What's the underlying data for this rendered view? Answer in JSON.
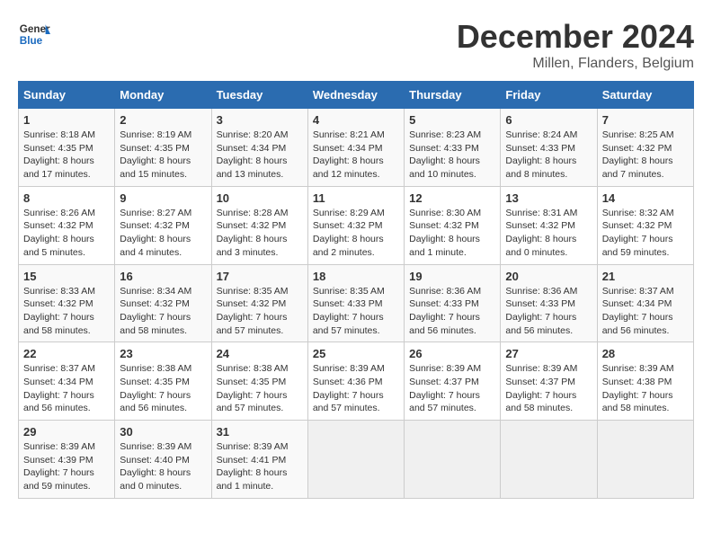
{
  "header": {
    "logo_line1": "General",
    "logo_line2": "Blue",
    "month": "December 2024",
    "location": "Millen, Flanders, Belgium"
  },
  "days_of_week": [
    "Sunday",
    "Monday",
    "Tuesday",
    "Wednesday",
    "Thursday",
    "Friday",
    "Saturday"
  ],
  "weeks": [
    [
      {
        "day": 1,
        "lines": [
          "Sunrise: 8:18 AM",
          "Sunset: 4:35 PM",
          "Daylight: 8 hours",
          "and 17 minutes."
        ]
      },
      {
        "day": 2,
        "lines": [
          "Sunrise: 8:19 AM",
          "Sunset: 4:35 PM",
          "Daylight: 8 hours",
          "and 15 minutes."
        ]
      },
      {
        "day": 3,
        "lines": [
          "Sunrise: 8:20 AM",
          "Sunset: 4:34 PM",
          "Daylight: 8 hours",
          "and 13 minutes."
        ]
      },
      {
        "day": 4,
        "lines": [
          "Sunrise: 8:21 AM",
          "Sunset: 4:34 PM",
          "Daylight: 8 hours",
          "and 12 minutes."
        ]
      },
      {
        "day": 5,
        "lines": [
          "Sunrise: 8:23 AM",
          "Sunset: 4:33 PM",
          "Daylight: 8 hours",
          "and 10 minutes."
        ]
      },
      {
        "day": 6,
        "lines": [
          "Sunrise: 8:24 AM",
          "Sunset: 4:33 PM",
          "Daylight: 8 hours",
          "and 8 minutes."
        ]
      },
      {
        "day": 7,
        "lines": [
          "Sunrise: 8:25 AM",
          "Sunset: 4:32 PM",
          "Daylight: 8 hours",
          "and 7 minutes."
        ]
      }
    ],
    [
      {
        "day": 8,
        "lines": [
          "Sunrise: 8:26 AM",
          "Sunset: 4:32 PM",
          "Daylight: 8 hours",
          "and 5 minutes."
        ]
      },
      {
        "day": 9,
        "lines": [
          "Sunrise: 8:27 AM",
          "Sunset: 4:32 PM",
          "Daylight: 8 hours",
          "and 4 minutes."
        ]
      },
      {
        "day": 10,
        "lines": [
          "Sunrise: 8:28 AM",
          "Sunset: 4:32 PM",
          "Daylight: 8 hours",
          "and 3 minutes."
        ]
      },
      {
        "day": 11,
        "lines": [
          "Sunrise: 8:29 AM",
          "Sunset: 4:32 PM",
          "Daylight: 8 hours",
          "and 2 minutes."
        ]
      },
      {
        "day": 12,
        "lines": [
          "Sunrise: 8:30 AM",
          "Sunset: 4:32 PM",
          "Daylight: 8 hours",
          "and 1 minute."
        ]
      },
      {
        "day": 13,
        "lines": [
          "Sunrise: 8:31 AM",
          "Sunset: 4:32 PM",
          "Daylight: 8 hours",
          "and 0 minutes."
        ]
      },
      {
        "day": 14,
        "lines": [
          "Sunrise: 8:32 AM",
          "Sunset: 4:32 PM",
          "Daylight: 7 hours",
          "and 59 minutes."
        ]
      }
    ],
    [
      {
        "day": 15,
        "lines": [
          "Sunrise: 8:33 AM",
          "Sunset: 4:32 PM",
          "Daylight: 7 hours",
          "and 58 minutes."
        ]
      },
      {
        "day": 16,
        "lines": [
          "Sunrise: 8:34 AM",
          "Sunset: 4:32 PM",
          "Daylight: 7 hours",
          "and 58 minutes."
        ]
      },
      {
        "day": 17,
        "lines": [
          "Sunrise: 8:35 AM",
          "Sunset: 4:32 PM",
          "Daylight: 7 hours",
          "and 57 minutes."
        ]
      },
      {
        "day": 18,
        "lines": [
          "Sunrise: 8:35 AM",
          "Sunset: 4:33 PM",
          "Daylight: 7 hours",
          "and 57 minutes."
        ]
      },
      {
        "day": 19,
        "lines": [
          "Sunrise: 8:36 AM",
          "Sunset: 4:33 PM",
          "Daylight: 7 hours",
          "and 56 minutes."
        ]
      },
      {
        "day": 20,
        "lines": [
          "Sunrise: 8:36 AM",
          "Sunset: 4:33 PM",
          "Daylight: 7 hours",
          "and 56 minutes."
        ]
      },
      {
        "day": 21,
        "lines": [
          "Sunrise: 8:37 AM",
          "Sunset: 4:34 PM",
          "Daylight: 7 hours",
          "and 56 minutes."
        ]
      }
    ],
    [
      {
        "day": 22,
        "lines": [
          "Sunrise: 8:37 AM",
          "Sunset: 4:34 PM",
          "Daylight: 7 hours",
          "and 56 minutes."
        ]
      },
      {
        "day": 23,
        "lines": [
          "Sunrise: 8:38 AM",
          "Sunset: 4:35 PM",
          "Daylight: 7 hours",
          "and 56 minutes."
        ]
      },
      {
        "day": 24,
        "lines": [
          "Sunrise: 8:38 AM",
          "Sunset: 4:35 PM",
          "Daylight: 7 hours",
          "and 57 minutes."
        ]
      },
      {
        "day": 25,
        "lines": [
          "Sunrise: 8:39 AM",
          "Sunset: 4:36 PM",
          "Daylight: 7 hours",
          "and 57 minutes."
        ]
      },
      {
        "day": 26,
        "lines": [
          "Sunrise: 8:39 AM",
          "Sunset: 4:37 PM",
          "Daylight: 7 hours",
          "and 57 minutes."
        ]
      },
      {
        "day": 27,
        "lines": [
          "Sunrise: 8:39 AM",
          "Sunset: 4:37 PM",
          "Daylight: 7 hours",
          "and 58 minutes."
        ]
      },
      {
        "day": 28,
        "lines": [
          "Sunrise: 8:39 AM",
          "Sunset: 4:38 PM",
          "Daylight: 7 hours",
          "and 58 minutes."
        ]
      }
    ],
    [
      {
        "day": 29,
        "lines": [
          "Sunrise: 8:39 AM",
          "Sunset: 4:39 PM",
          "Daylight: 7 hours",
          "and 59 minutes."
        ]
      },
      {
        "day": 30,
        "lines": [
          "Sunrise: 8:39 AM",
          "Sunset: 4:40 PM",
          "Daylight: 8 hours",
          "and 0 minutes."
        ]
      },
      {
        "day": 31,
        "lines": [
          "Sunrise: 8:39 AM",
          "Sunset: 4:41 PM",
          "Daylight: 8 hours",
          "and 1 minute."
        ]
      },
      null,
      null,
      null,
      null
    ]
  ]
}
